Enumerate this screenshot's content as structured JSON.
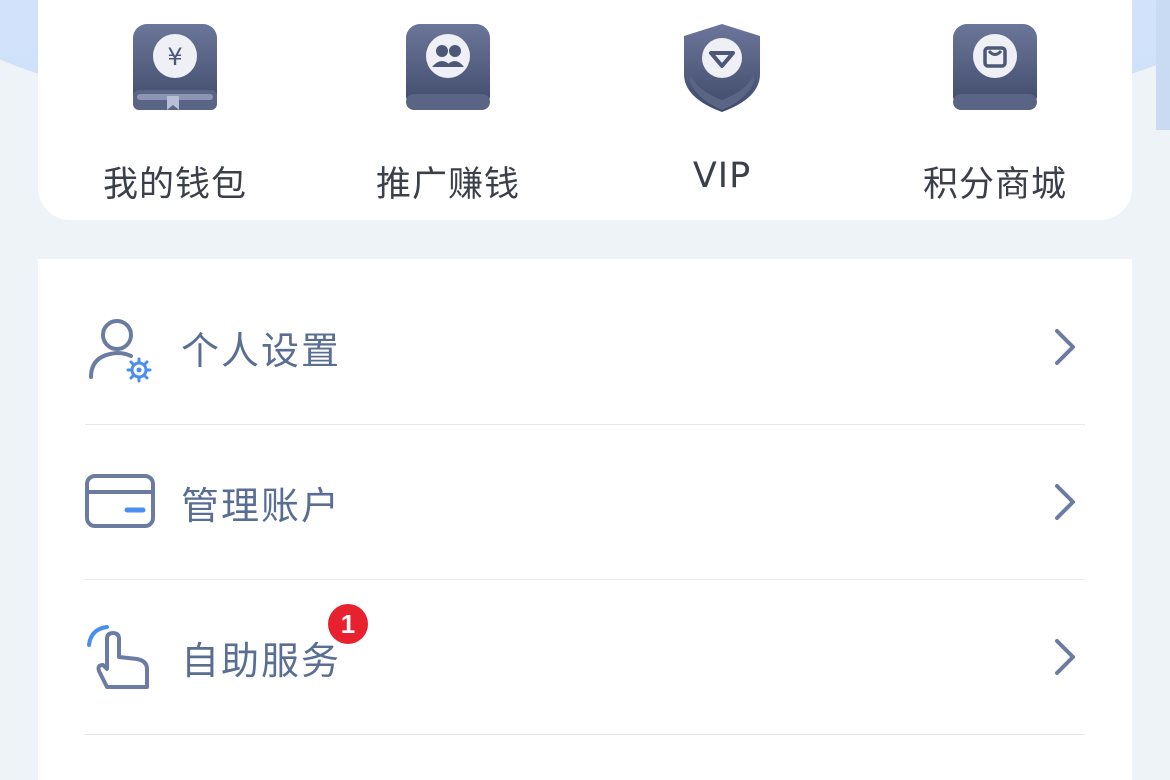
{
  "quick_actions": [
    {
      "label": "我的钱包",
      "icon": "wallet-icon"
    },
    {
      "label": "推广赚钱",
      "icon": "promote-icon"
    },
    {
      "label": "VIP",
      "icon": "vip-shield-icon"
    },
    {
      "label": "积分商城",
      "icon": "shopping-bag-icon"
    }
  ],
  "menu": [
    {
      "label": "个人设置",
      "icon": "user-settings-icon"
    },
    {
      "label": "管理账户",
      "icon": "card-icon"
    },
    {
      "label": "自助服务",
      "icon": "tap-hand-icon",
      "badge": "1"
    }
  ],
  "colors": {
    "icon_dark": "#4d5878",
    "icon_light": "#7b87a8",
    "menu_text": "#5a6e94",
    "badge_red": "#e8212f",
    "accent_blue": "#4a8ef0"
  }
}
